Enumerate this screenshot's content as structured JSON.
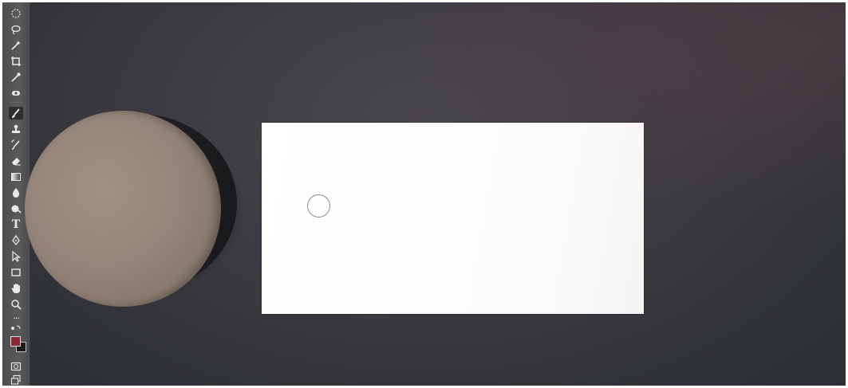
{
  "app": {
    "tool_panel": {
      "tools": [
        {
          "name": "elliptical-marquee-tool",
          "icon": "ellipse-marquee-icon",
          "active": false
        },
        {
          "name": "lasso-tool",
          "icon": "lasso-icon",
          "active": false
        },
        {
          "name": "magic-wand-tool",
          "icon": "magic-wand-icon",
          "active": false
        },
        {
          "name": "crop-tool",
          "icon": "crop-icon",
          "active": false
        },
        {
          "name": "eyedropper-tool",
          "icon": "eyedropper-icon",
          "active": false
        },
        {
          "name": "spot-healing-tool",
          "icon": "bandage-icon",
          "active": false
        },
        {
          "name": "brush-tool",
          "icon": "brush-icon",
          "active": true
        },
        {
          "name": "clone-stamp-tool",
          "icon": "stamp-icon",
          "active": false
        },
        {
          "name": "history-brush-tool",
          "icon": "history-brush-icon",
          "active": false
        },
        {
          "name": "eraser-tool",
          "icon": "eraser-icon",
          "active": false
        },
        {
          "name": "gradient-tool",
          "icon": "gradient-icon",
          "active": false
        },
        {
          "name": "blur-tool",
          "icon": "drop-icon",
          "active": false
        },
        {
          "name": "dodge-tool",
          "icon": "dodge-icon",
          "active": false
        },
        {
          "name": "type-tool",
          "icon": "type-icon",
          "active": false,
          "glyph": "T"
        },
        {
          "name": "pen-tool",
          "icon": "pen-icon",
          "active": false
        },
        {
          "name": "path-selection-tool",
          "icon": "arrow-icon",
          "active": false
        },
        {
          "name": "rectangle-tool",
          "icon": "rectangle-icon",
          "active": false
        },
        {
          "name": "hand-tool",
          "icon": "hand-icon",
          "active": false
        },
        {
          "name": "zoom-tool",
          "icon": "magnifier-icon",
          "active": false
        },
        {
          "name": "more-tools",
          "icon": "ellipsis-icon",
          "active": false,
          "glyph": "···"
        }
      ],
      "foreground_color": "#8b2a36",
      "background_color": "#1b1b1b"
    },
    "colors": {
      "toolbar_bg": "#555557",
      "workspace_bg": "#3b3a40",
      "canvas_bg": "#ffffff",
      "dial_top": "#96857a",
      "dial_side": "#232325"
    }
  }
}
